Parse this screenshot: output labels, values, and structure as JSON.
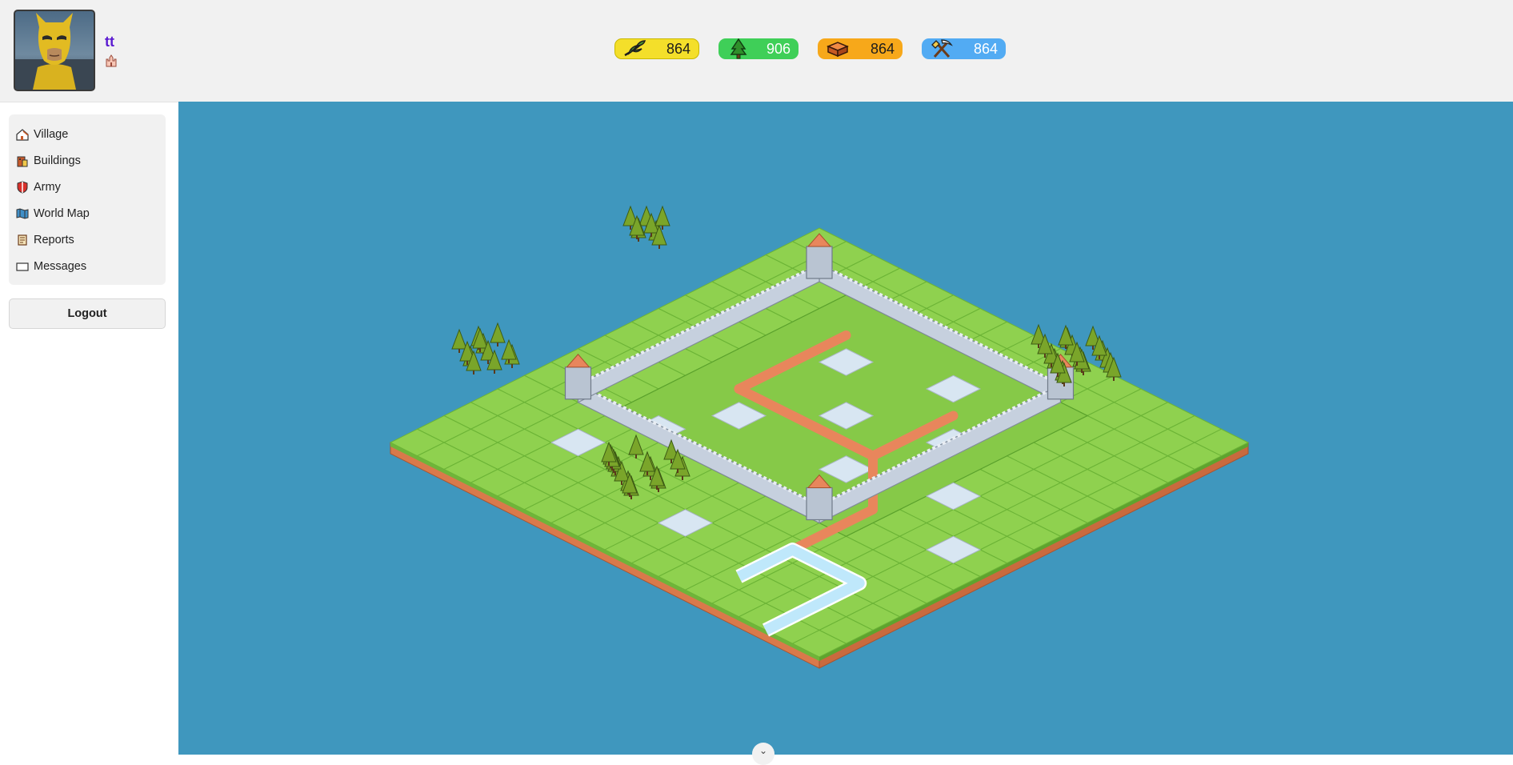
{
  "player": {
    "name": "tt"
  },
  "resources": {
    "food": {
      "value": "864",
      "icon": "wheat-icon",
      "color": "#f4df2a"
    },
    "wood": {
      "value": "906",
      "icon": "tree-icon",
      "color": "#3fcf58"
    },
    "clay": {
      "value": "864",
      "icon": "brick-icon",
      "color": "#f7a81a"
    },
    "iron": {
      "value": "864",
      "icon": "pickaxe-icon",
      "color": "#52abf3"
    }
  },
  "nav": {
    "items": [
      {
        "label": "Village",
        "icon": "house-icon"
      },
      {
        "label": "Buildings",
        "icon": "buildings-icon"
      },
      {
        "label": "Army",
        "icon": "shield-icon"
      },
      {
        "label": "World Map",
        "icon": "map-icon"
      },
      {
        "label": "Reports",
        "icon": "scroll-icon"
      },
      {
        "label": "Messages",
        "icon": "envelope-icon"
      }
    ],
    "logout_label": "Logout"
  },
  "map": {
    "background": "#3f97be",
    "grass": "#8fd14f",
    "dirt": "#e8865c",
    "wall": "#c6d0de",
    "water": "#bfe8fb",
    "empty_plot": "#d8e6f2"
  }
}
